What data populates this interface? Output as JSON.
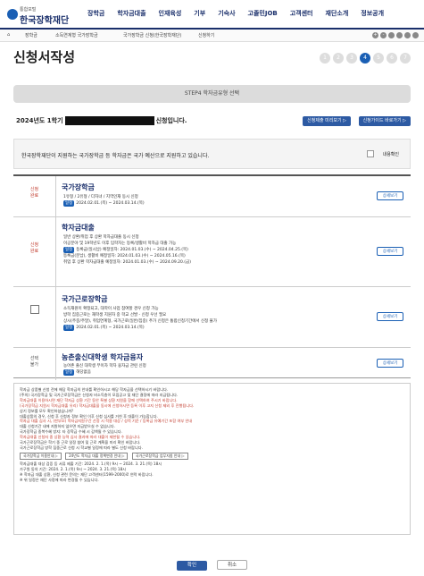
{
  "logo": {
    "sub": "통합포털",
    "name": "한국장학재단"
  },
  "menu": [
    "장학금",
    "학자금대출",
    "인재육성",
    "기부",
    "기숙사",
    "고졸민JOB",
    "고객센터",
    "재단소개",
    "정보공개"
  ],
  "breadcrumb": [
    "장학금",
    "소득연계형 국가장학금",
    "국가장학금 신청(한국장학재단)",
    "신청하기"
  ],
  "page_title": "신청서작성",
  "steps": [
    "1",
    "2",
    "3",
    "4",
    "5",
    "6",
    "7"
  ],
  "active_step": "4",
  "step_label": "STEP4 학자금유형 선택",
  "term_prefix": "2024년도 1학기",
  "term_suffix": "신청입니다.",
  "buttons": {
    "guide": "신청제출 미리보기 ▷",
    "help": "신청가이드 바로가기 ▷"
  },
  "notice": {
    "text": "한국장학재단이 지원하는 국가장학금 등 학자금은 국가 예산으로 지원하고 있습니다.",
    "check_label": "내용확인"
  },
  "rows": [
    {
      "status": "신청\n완료",
      "title": "국가장학금",
      "lines": [
        "1유형 / 2유형 / 다자녀 / 지역인재 동시 신청"
      ],
      "period": "2024.02.01.(목) ~ 2024.03.14.(목)",
      "more": "상세보기"
    },
    {
      "status": "신청\n완료",
      "title": "학자금대출",
      "lines": [
        "일반 상환/취업 후 상환 학자금대출 동시 신청",
        "이공분야 및 19학년도 이후 입학자는 등록/생활비 학자금 대출 가능"
      ],
      "periods": [
        "등록금(일시납) 예정일자: 2024.01.03.(수) ~ 2024.04.25.(목)",
        "등록금(분납), 생활비 예정일자: 2024.01.03.(수) ~ 2024.05.16.(목)",
        "취업 후 상환 학자금대출 예정일자: 2024.01.03.(수) ~ 2024.09.20.(금)"
      ],
      "more": "상세보기"
    },
    {
      "status": "",
      "title": "국가근로장학금",
      "lines": [
        "소득재원이 확정되고, 대학이 사업 참여할 경우 신청 가능",
        "방학 집중근로는 재학생 지원자 중 학교 선발 - 신청 우선 필요",
        "상시(주중/주말), 취업연계형, 국가근로(일반/집중) 추가 신청은 통합신청기간에서 신청 불가"
      ],
      "period": "2024.02.01.(목) ~ 2024.03.14.(목)",
      "more": "상세보기"
    },
    {
      "status": "선택\n불가",
      "title": "농촌출신대학생 학자금융자",
      "lines": [
        "농어촌 출신 대학생 무이자 학자 융자금 관련 신청"
      ],
      "period": "해당없음",
      "more": "상세보기"
    }
  ],
  "notes": [
    "학자금 상품별 신청 전에 해당 학자금의 안내를 확인하시고 해당 학자금을 선택하시기 바랍니다.",
    "(주의) 국가장학금 및 국가근로장학금은 신청자 비소득층이 모집공고 및 재단 결정에 따라 지급됩니다.",
    "학자금대출 이용하시면 재단 학자금 상환 기간 동안 특별 상환 지원을 함께 선택하여 주시기 바랍니다.",
    "(국가장학금 지원시 학자금대출 유리) 학자금대출을 동시에 신청하시면 등록 이후 고지 신청 제외 후 진행됩니다.",
    "상기 정보를 모두 확인하셨습니까?",
    "대출상품의 경우, 신청 후 신청자 정보 확인 이후 신청 심사를 거친 후 대출이 가능합니다.",
    "학자금 대출 심사 시, (한부모) 학자금지원구간 산정 시 적용 대상 / 성적 기준 / 등록금 유예기간 포함 여부 안내",
    "대출 신청기간 내에 지원하지 않으면 지급받으실 수 없습니다.",
    "국가장학금 중복수혜 방지: 타 장학금 수혜 시 감액될 수 있습니다.",
    "학자금대출 신청자 중 상환 능력 심사 결과에 따라 대출이 제한될 수 있습니다.",
    "국가근로장학금은 학기 중 근로 일정 참여 및 근로 계획을 미리 확인 바랍니다.",
    "국가근로장학금 방학 집중근로 신청 시 학교별 일정에 따라 별도 신청 바랍니다.",
    "학자금대출 대상 검증 등 서류 제출 기간: 2024. 2. 1.(목) 9시 ~ 2024. 3. 21.(목) 18시",
    "가구원 동의 기간: 2024. 2. 1.(목) 9시 ~ 2024. 3. 21.(목) 18시",
    "※ 학자금 대출 상환, 신청 관련 문의는 재단 고객센터(1599-2000)로 연락 바랍니다.",
    "※ 위 일정은 재단 사정에 따라 변경될 수 있습니다."
  ],
  "note_buttons": [
    "국가장학금 이용안내 ▷",
    "24년도 학자금 대출 정책변경 안내 ▷",
    "국가근로장학금 업무지침 안내 ▷"
  ],
  "bottom": {
    "confirm": "확인",
    "cancel": "취소"
  }
}
